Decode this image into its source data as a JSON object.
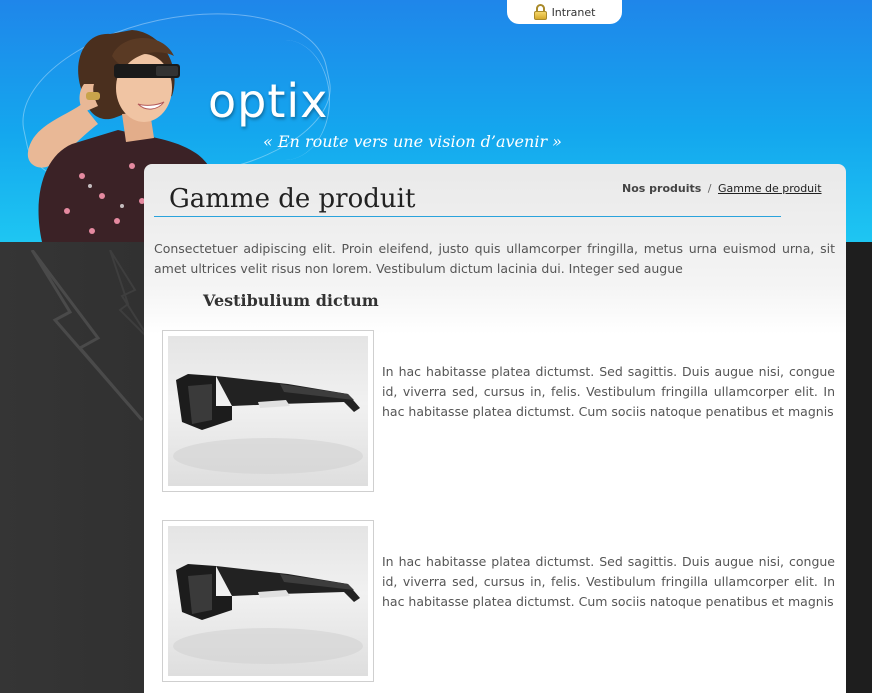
{
  "header": {
    "logo_text": "optix",
    "tagline": "« En route vers une vision d’avenir »",
    "intranet_label": "Intranet"
  },
  "page": {
    "title": "Gamme de produit",
    "breadcrumb": {
      "home": "Nos produits",
      "separator": "/",
      "current": "Gamme de produit"
    },
    "intro": "Consectetuer adipiscing elit. Proin eleifend, justo quis ullamcorper fringilla, metus urna euismod urna, sit amet ultrices velit risus non lorem. Vestibulum dictum lacinia dui. Integer sed augue",
    "section_title": "Vestibulium dictum"
  },
  "products": [
    {
      "image": "sunglasses-product-photo",
      "description": "In hac habitasse platea dictumst. Sed sagittis. Duis augue nisi, congue id, viverra sed, cursus in, felis. Vestibulum fringilla ullamcorper elit. In hac habitasse platea dictumst. Cum sociis natoque penatibus et magnis"
    },
    {
      "image": "sunglasses-product-photo",
      "description": "In hac habitasse platea dictumst. Sed sagittis. Duis augue nisi, congue id, viverra sed, cursus in, felis. Vestibulum fringilla ullamcorper elit. In hac habitasse platea dictumst. Cum sociis natoque penatibus et magnis"
    }
  ],
  "colors": {
    "header_blue": "#1f86ea",
    "header_cyan": "#1ec6f2",
    "accent_line": "#2aa3dc",
    "dark_bg": "#2b2b2b",
    "text": "#555555"
  }
}
